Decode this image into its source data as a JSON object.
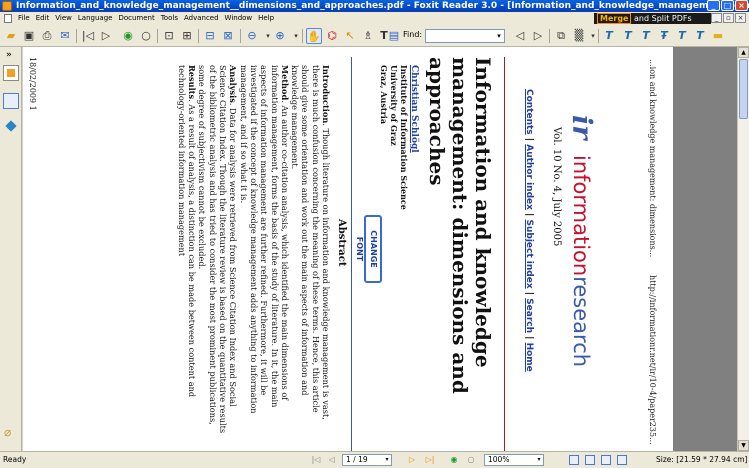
{
  "window": {
    "title": "Information_and_knowledge_management__dimensions_and_approaches.pdf - Foxit Reader 3.0 - [Information_and_knowledge_management__dimensions_anc",
    "minimize": "_",
    "maximize": "□",
    "close": "×"
  },
  "menu": {
    "items": [
      "File",
      "Edit",
      "View",
      "Language",
      "Document",
      "Tools",
      "Advanced",
      "Window",
      "Help"
    ],
    "merge_word": "Merge",
    "merge_rest": " and Split PDFs",
    "mdi_min": "_",
    "mdi_restore": "▫",
    "mdi_close": "×"
  },
  "toolbar": {
    "find_label": "Find:",
    "find_value": ""
  },
  "left_panel": {
    "collapse": "»"
  },
  "document": {
    "header_left": "...ion and knowledge management: dimensions...",
    "header_right": "http://informationr.net/ir/10-4/paper235...",
    "header_date": "18/02/2009 1",
    "logo_ir": "ir",
    "logo_ir_r": "",
    "logo_info_a": "information",
    "logo_info_b": "research",
    "vol": "Vol. 10 No. 4, July 2005",
    "nav_contents": "Contents",
    "nav_author_index": "Author index",
    "nav_subject_index": "Subject index",
    "nav_search": "Search",
    "nav_home": "Home",
    "nav_pipe": " | ",
    "title": "Information and knowledge management: dimensions and approaches",
    "author": "Christian Schlögl",
    "affil_1": "Institute of Information Science",
    "affil_2": "University of Graz",
    "affil_3": "Graz, Austria",
    "change_font": "CHANGE FONT",
    "abstract_title": "Abstract",
    "intro_label": "Introduction",
    "intro_text": ". Though literature on information and knowledge management is vast, there is much confusion concerning the meaning of these terms. Hence, this article should give some orientation and work out the main aspects of information and knowledge management.",
    "method_label": "Method",
    "method_text": ". An author co-citation analysis, which identified the main dimensions of information management, forms the basis of the study of literature. In it, the main aspects of information management are further refined. Furthermore, it will be investigated if the concept of knowledge management adds anything to information management, and if so what it is.",
    "analysis_label": "Analysis",
    "analysis_text": ". Data for analysis were retrieved from Science Citation Index and Social Science Citation Index. Though the literature review is based on the quantitative results of the bibliometric analysis and has tried to consider the most prominent publications, some degree of subjectivism cannot be excluded.",
    "results_label": "Results",
    "results_text": ". As a result of analysis, a distinction can be made between content and technology-oriented information management"
  },
  "status": {
    "ready": "Ready",
    "page_value": "1 / 19",
    "zoom_value": "100%",
    "size_text": "Size: [21.59 * 27.94 cm]"
  }
}
